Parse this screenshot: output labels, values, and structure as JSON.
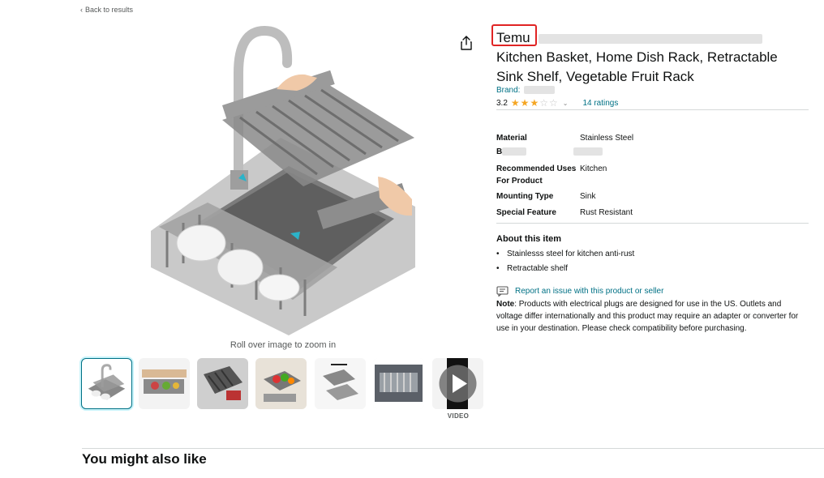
{
  "nav": {
    "back_chevron": "‹",
    "back_label": "Back to results"
  },
  "product": {
    "title_brand": "Temu",
    "title_line2": "Kitchen Basket, Home Dish Rack, Retractable",
    "title_line3": "Sink Shelf, Vegetable Fruit Rack",
    "brand_label": "Brand:",
    "rating_value": "3.2",
    "rating_fraction": 0.64,
    "rating_chevron": "⌄",
    "ratings_count": "14 ratings",
    "zoom_hint": "Roll over image to zoom in",
    "video_label": "VIDEO"
  },
  "specs": {
    "rows": [
      {
        "key": "Material",
        "value": "Stainless Steel"
      },
      {
        "key": "B",
        "value": ""
      },
      {
        "key": "Recommended Uses For Product",
        "value": "Kitchen"
      },
      {
        "key": "Mounting Type",
        "value": "Sink"
      },
      {
        "key": "Special Feature",
        "value": "Rust Resistant"
      }
    ]
  },
  "about": {
    "title": "About this item",
    "bullets": [
      "Stainlesss steel for kitchen anti-rust",
      "Retractable shelf"
    ],
    "report_link": "Report an issue with this product or seller",
    "note_label": "Note",
    "note_text": ": Products with electrical plugs are designed for use in the US. Outlets and voltage differ internationally and this product may require an adapter or converter for use in your destination. Please check compatibility before purchasing."
  },
  "section": {
    "title": "You might also like"
  },
  "icons": {
    "share": "share-icon",
    "report": "report-flag-icon",
    "play": "play-icon"
  },
  "colors": {
    "link": "#007185",
    "star": "#f5a623",
    "highlight": "#e02424",
    "divider": "#d5d9d9"
  }
}
